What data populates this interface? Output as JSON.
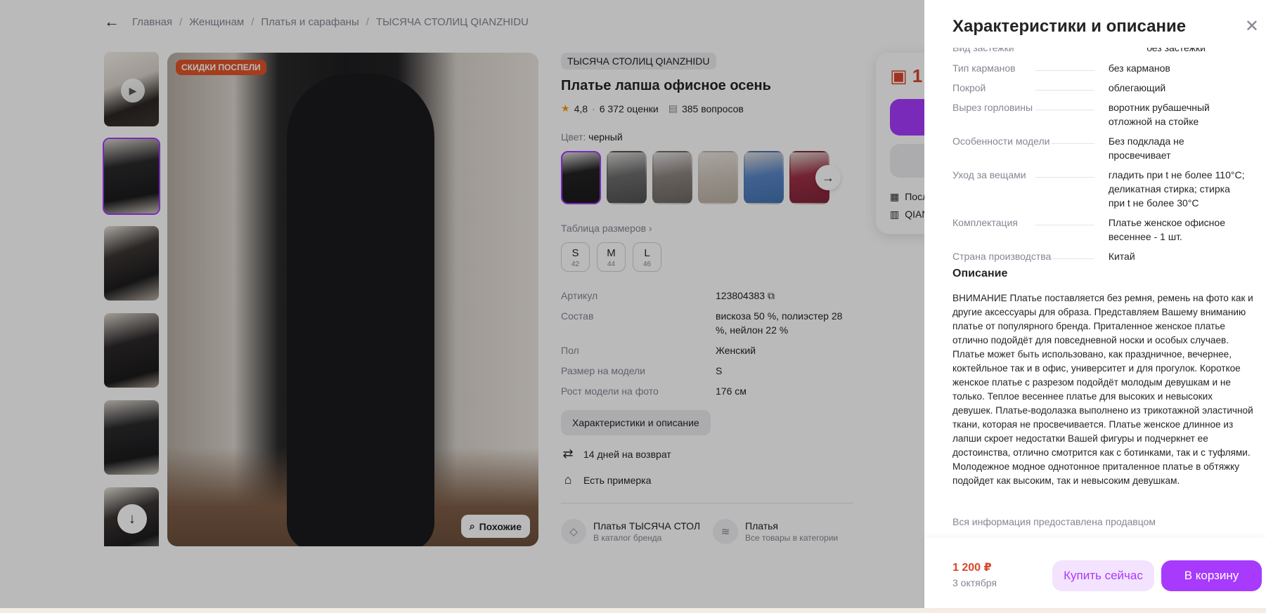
{
  "breadcrumb": {
    "items": [
      "Главная",
      "Женщинам",
      "Платья и сарафаны",
      "ТЫСЯЧА СТОЛИЦ QIANZHIDU"
    ]
  },
  "gallery": {
    "badge": "СКИДКИ ПОСПЕЛИ",
    "similar_label": "Похожие"
  },
  "product": {
    "brand": "ТЫСЯЧА СТОЛИЦ QIANZHIDU",
    "title": "Платье лапша офисное осень",
    "rating": "4,8",
    "reviews": "6 372 оценки",
    "questions": "385 вопросов",
    "color_label": "Цвет:",
    "color_value": "черный",
    "size_table": "Таблица размеров ›",
    "sizes": [
      {
        "label": "S",
        "ru": "42"
      },
      {
        "label": "M",
        "ru": "44"
      },
      {
        "label": "L",
        "ru": "46"
      }
    ],
    "props": [
      {
        "key": "Артикул",
        "value": "123804383 ⧉"
      },
      {
        "key": "Состав",
        "value": "вискоза 50 %, полиэстер 28 %, нейлон 22 %"
      },
      {
        "key": "Пол",
        "value": "Женский"
      },
      {
        "key": "Размер на модели",
        "value": "S"
      },
      {
        "key": "Рост модели на фото",
        "value": "176 см"
      }
    ],
    "chars_button": "Характеристики и описание",
    "features": [
      "14 дней на возврат",
      "Есть примерка"
    ],
    "links": [
      {
        "title": "Платья ТЫСЯЧА СТОЛИЦ QIANZHIDU",
        "sub": "В каталог бренда"
      },
      {
        "title": "Платья",
        "sub": "Все товары в категории"
      }
    ]
  },
  "buy_panel": {
    "price_partial": "1",
    "row1": "Посл",
    "row2": "QIAN"
  },
  "drawer": {
    "title": "Характеристики и описание",
    "clipped_row": {
      "key": "Вид застежки",
      "value": "без застежки"
    },
    "props": [
      {
        "key": "Тип карманов",
        "value": "без карманов"
      },
      {
        "key": "Покрой",
        "value": "облегающий"
      },
      {
        "key": "Вырез горловины",
        "value": "воротник рубашечный отложной на стойке"
      },
      {
        "key": "Особенности модели",
        "value": "Без подклада не просвечивает"
      },
      {
        "key": "Уход за вещами",
        "value": "гладить при t не более 110°C; деликатная стирка; стирка при t не более 30°C"
      },
      {
        "key": "Комплектация",
        "value": "Платье женское офисное весеннее - 1 шт."
      },
      {
        "key": "Страна производства",
        "value": "Китай"
      }
    ],
    "description_title": "Описание",
    "description": "ВНИМАНИЕ Платье поставляется без ремня, ремень на фото как и другие аксессуары для образа. Представляем Вашему вниманию платье от популярного бренда. Приталенное женское платье отлично подойдёт для повседневной носки и особых случаев. Платье может быть использовано, как праздничное, вечернее, коктейльное так и в офис, университет и для прогулок. Короткое женское платье с разрезом подойдёт молодым девушкам и не только. Теплое весеннее платье для высоких и невысоких девушек. Платье-водолазка выполнено из трикотажной эластичной ткани, которая не просвечивается. Платье женское длинное из лапши скроет недостатки Вашей фигуры и подчеркнет ее достоинства, отлично смотрится как с ботинками, так и с туфлями. Молодежное модное однотонное приталенное платье в обтяжку подойдет как высоким, так и невысоким девушкам.",
    "seller_note": "Вся информация предоставлена продавцом",
    "footer": {
      "price": "1 200 ₽",
      "date": "3 октября",
      "buy_now": "Купить сейчас",
      "add_to_cart": "В корзину"
    }
  },
  "colors": {
    "accent": "#a73afd",
    "price": "#d9472b",
    "badge": "#e0542a",
    "muted": "#868695"
  }
}
